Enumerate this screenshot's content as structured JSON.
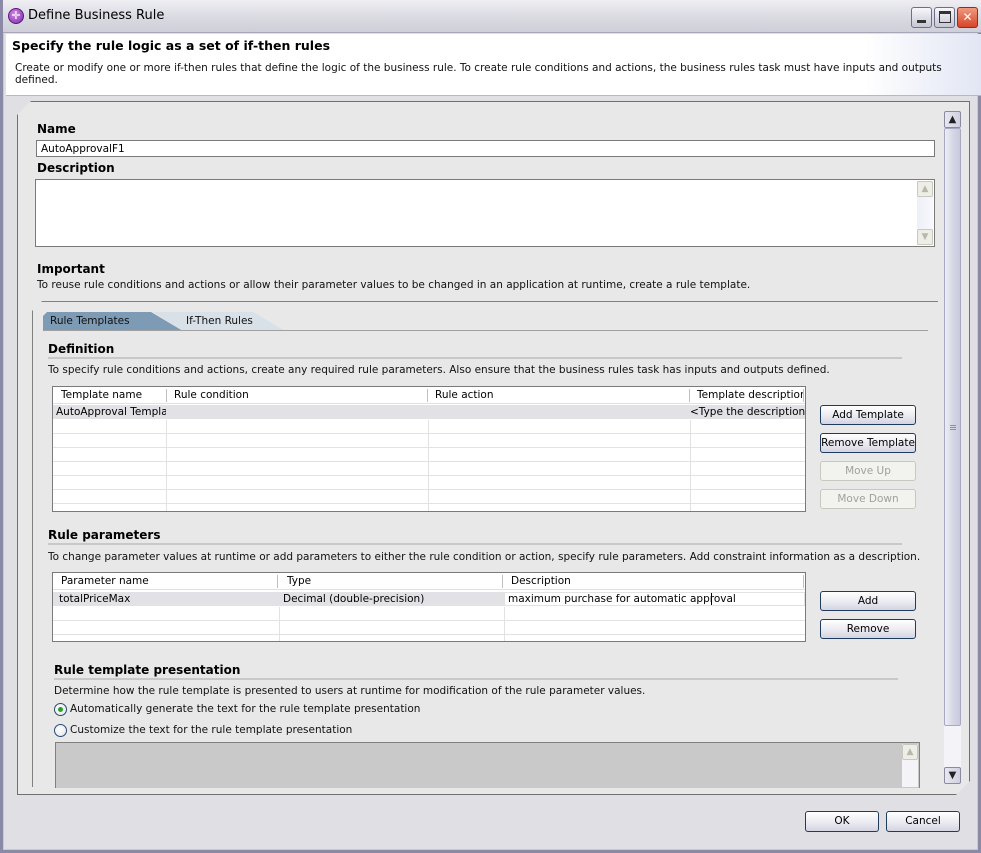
{
  "window": {
    "title": "Define Business Rule",
    "controls": {
      "minimize": "minimize",
      "maximize": "maximize",
      "close": "close"
    }
  },
  "header": {
    "title": "Specify the rule logic as a set of if-then rules",
    "description": "Create or modify one or more if-then rules that define the logic of the business rule. To create rule conditions and actions, the business rules task must have inputs and outputs defined."
  },
  "form": {
    "name_label": "Name",
    "name_value": "AutoApprovalF1",
    "description_label": "Description",
    "description_value": "",
    "important_label": "Important",
    "important_text": "To reuse rule conditions and actions or allow their parameter values to be changed in an application at runtime, create a rule template."
  },
  "tabs": [
    {
      "label": "Rule Templates",
      "active": true
    },
    {
      "label": "If-Then Rules",
      "active": false
    }
  ],
  "definition": {
    "title": "Definition",
    "text": "To specify rule conditions and actions, create any required rule parameters. Also ensure that the business rules task has inputs and outputs defined.",
    "columns": [
      "Template name",
      "Rule condition",
      "Rule action",
      "Template description"
    ],
    "rows": [
      [
        "AutoApproval Template",
        "",
        "",
        "<Type the description here>"
      ]
    ],
    "buttons": {
      "add": "Add Template",
      "remove": "Remove Template",
      "move_up": "Move Up",
      "move_down": "Move Down"
    }
  },
  "parameters": {
    "title": "Rule parameters",
    "text": "To change parameter values at runtime or add parameters to either the rule condition or action, specify rule parameters. Add constraint information as a description.",
    "columns": [
      "Parameter name",
      "Type",
      "Description"
    ],
    "rows": [
      [
        "totalPriceMax",
        "Decimal (double-precision)",
        "maximum purchase for automatic approval"
      ]
    ],
    "buttons": {
      "add": "Add",
      "remove": "Remove"
    }
  },
  "presentation": {
    "title": "Rule template presentation",
    "text": "Determine how the rule template is presented to users at runtime for modification of the rule parameter values.",
    "options": [
      {
        "label": "Automatically generate the text for the rule template presentation",
        "selected": true
      },
      {
        "label": "Customize the text for the rule template presentation",
        "selected": false
      }
    ],
    "custom_text": ""
  },
  "footer": {
    "ok": "OK",
    "cancel": "Cancel"
  }
}
